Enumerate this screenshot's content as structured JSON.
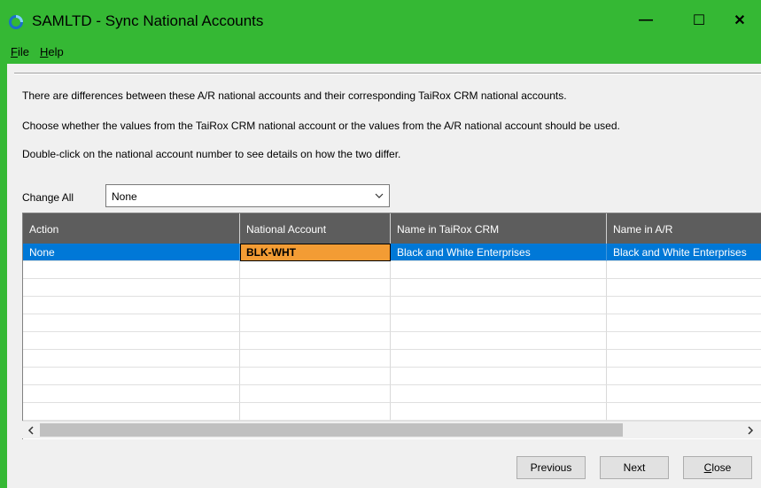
{
  "window": {
    "title": "SAMLTD - Sync National Accounts",
    "controls": {
      "minimize": "—",
      "maximize": "☐",
      "close": "✕"
    }
  },
  "menu": [
    {
      "label_underlined": "F",
      "label_rest": "ile"
    },
    {
      "label_underlined": "H",
      "label_rest": "elp"
    }
  ],
  "messages": [
    "There are differences between these A/R national accounts and their corresponding TaiRox CRM national accounts.",
    "Choose whether the values from the TaiRox CRM national account or the values from the A/R national account should be used.",
    "Double-click on the national account number to see details on how the two differ."
  ],
  "change_all": {
    "label": "Change All",
    "value": "None"
  },
  "grid": {
    "columns": [
      "Action",
      "National Account",
      "Name in TaiRox CRM",
      "Name in A/R"
    ],
    "rows": [
      {
        "action": "None",
        "national_account": "BLK-WHT",
        "name_crm": "Black and White Enterprises",
        "name_ar": "Black and White Enterprises",
        "selected": true
      }
    ],
    "empty_rows": 9
  },
  "buttons": {
    "previous": "Previous",
    "next": "Next",
    "close_underlined": "C",
    "close_rest": "lose"
  },
  "colors": {
    "titlebar": "#35b834",
    "header": "#5d5d5d",
    "selection": "#0078d7",
    "highlight_cell": "#f39c34"
  }
}
